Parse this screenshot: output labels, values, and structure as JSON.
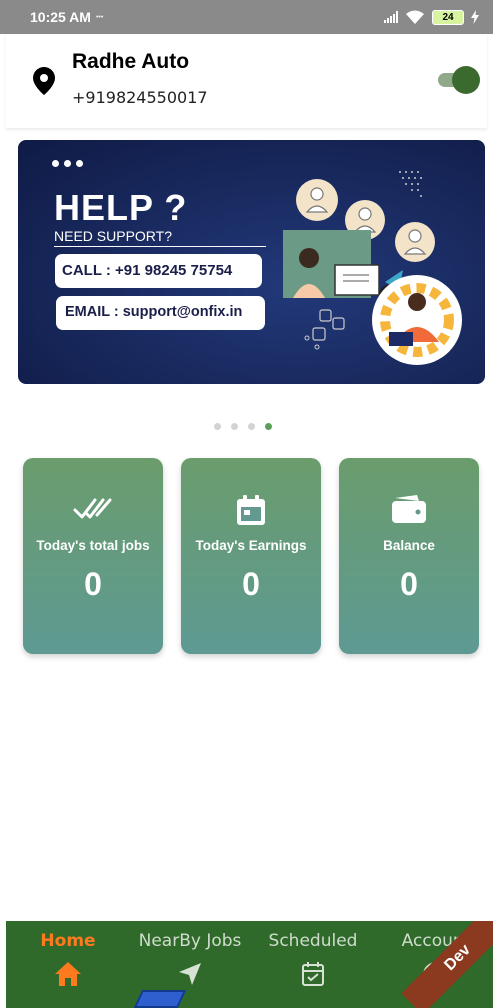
{
  "status_bar": {
    "time": "10:25 AM",
    "extra": "•••",
    "battery": "24"
  },
  "header": {
    "shop_name": "Radhe Auto",
    "phone": "+919824550017",
    "online_toggle": "on"
  },
  "banner": {
    "title": "HELP ?",
    "subtitle": "NEED SUPPORT?",
    "call": "CALL : +91 98245 75754",
    "email": "EMAIL : support@onfix.in",
    "bg_color": "#18285c"
  },
  "carousel": {
    "pages": 4,
    "active_index": 3
  },
  "stats": [
    {
      "label": "Today's total jobs",
      "value": "0",
      "icon": "double-check-icon"
    },
    {
      "label": "Today's Earnings",
      "value": "0",
      "icon": "calendar-icon"
    },
    {
      "label": "Balance",
      "value": "0",
      "icon": "wallet-icon"
    }
  ],
  "nav": {
    "home": "Home",
    "nearby": "NearBy Jobs",
    "scheduled": "Scheduled",
    "account": "Account",
    "ribbon": "Dev",
    "active": "home",
    "active_color": "#ff7a1f",
    "bg_color": "#2f6a2a"
  }
}
